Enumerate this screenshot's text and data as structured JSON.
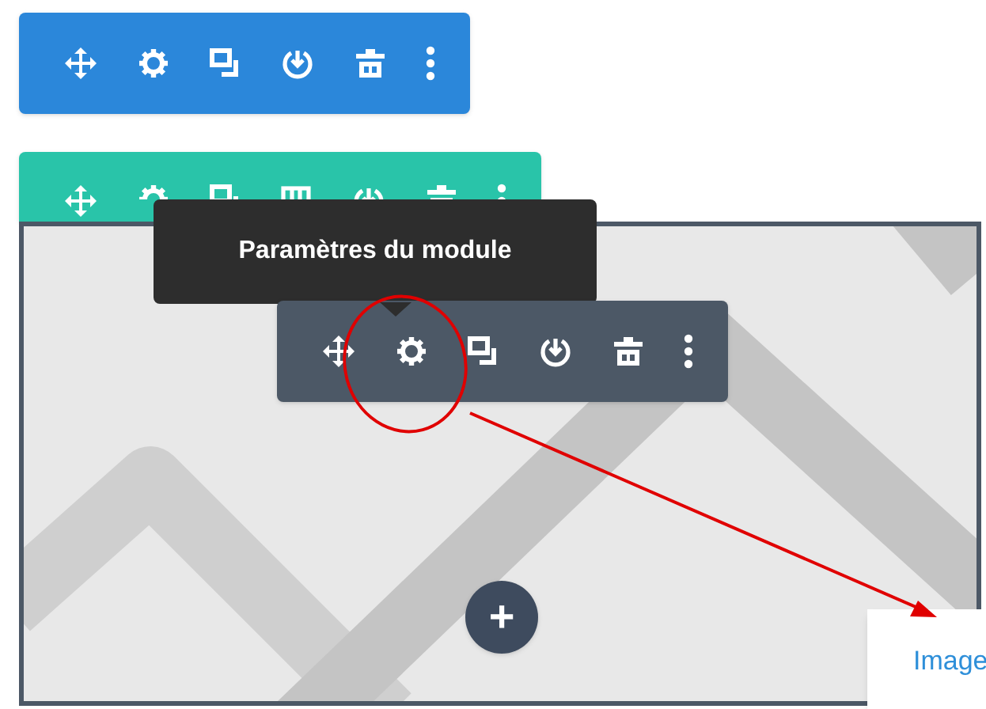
{
  "toolbars": [
    {
      "kind": "section",
      "color": "#2b87da"
    },
    {
      "kind": "row",
      "color": "#29c4a9"
    },
    {
      "kind": "module",
      "color": "#4c5866"
    }
  ],
  "tooltip": {
    "text": "Paramètres du module"
  },
  "add_button": {
    "label": "+"
  },
  "side_panel": {
    "item": "Image"
  }
}
